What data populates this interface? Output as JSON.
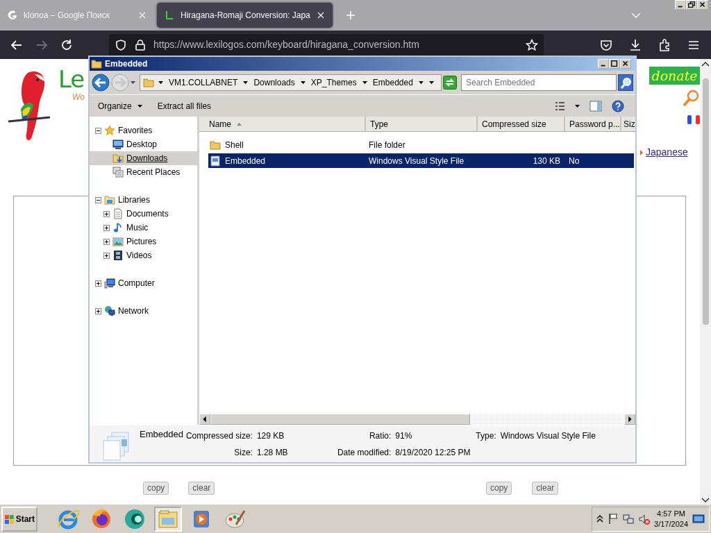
{
  "browser": {
    "tabs": [
      {
        "title": "klonoa – Google Поиск",
        "selected": false
      },
      {
        "title": "Hiragana-Romaji Conversion: Japa",
        "selected": true
      }
    ],
    "url": "https://www.lexilogos.com/keyboard/hiragana_conversion.htm"
  },
  "page": {
    "logo_text": "Le",
    "tagline": "Wo",
    "donate": "donate",
    "language_link": "Japanese",
    "button_groups": [
      [
        "copy",
        "clear"
      ],
      [
        "copy",
        "clear"
      ]
    ]
  },
  "explorer": {
    "title": "Embedded",
    "breadcrumb": [
      "VM1.COLLABNET",
      "Downloads",
      "XP_Themes",
      "Embedded"
    ],
    "search": {
      "placeholder": "Search Embedded"
    },
    "toolbar": [
      {
        "label": "Organize",
        "dropdown": true
      },
      {
        "label": "Extract all files",
        "dropdown": false
      }
    ],
    "nav": [
      {
        "label": "Favorites",
        "expanded": true,
        "children": [
          {
            "label": "Desktop",
            "hovered": false
          },
          {
            "label": "Downloads",
            "hovered": true
          },
          {
            "label": "Recent Places",
            "hovered": false
          }
        ]
      },
      {
        "label": "Libraries",
        "expanded": true,
        "children": [
          {
            "label": "Documents",
            "expanded": false
          },
          {
            "label": "Music",
            "expanded": false
          },
          {
            "label": "Pictures",
            "expanded": false
          },
          {
            "label": "Videos",
            "expanded": false
          }
        ]
      },
      {
        "label": "Computer",
        "expanded": false
      },
      {
        "label": "Network",
        "expanded": false
      }
    ],
    "columns": [
      "Name",
      "Type",
      "Compressed size",
      "Password p...",
      "Siz"
    ],
    "rows": [
      {
        "kind": "folder",
        "name": "Shell",
        "type": "File folder",
        "selected": false
      },
      {
        "kind": "file",
        "name": "Embedded",
        "type": "Windows Visual Style File",
        "compressed_size": "130 KB",
        "password": "No",
        "selected": true
      }
    ],
    "details": {
      "name": "Embedded",
      "fields": [
        {
          "label": "Compressed size:",
          "value": "129 KB"
        },
        {
          "label": "Ratio:",
          "value": "91%"
        },
        {
          "label": "Type:",
          "value": "Windows Visual Style File"
        },
        {
          "label": "Size:",
          "value": "1.28 MB"
        },
        {
          "label": "Date modified:",
          "value": "8/19/2020 12:25 PM"
        }
      ]
    }
  },
  "taskbar": {
    "start": "Start",
    "apps": [
      {
        "selected": false
      },
      {
        "selected": false
      },
      {
        "selected": false
      },
      {
        "selected": true
      },
      {
        "selected": false
      },
      {
        "selected": false
      }
    ],
    "clock": {
      "time": "4:57 PM",
      "date": "3/17/2024"
    }
  }
}
